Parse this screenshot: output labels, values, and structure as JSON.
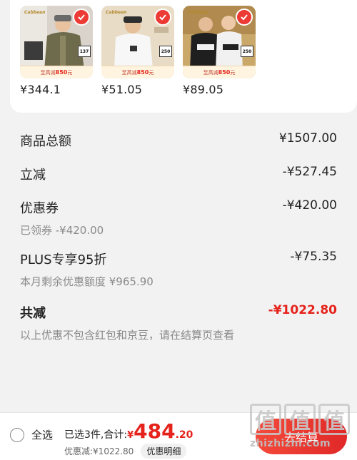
{
  "products": [
    {
      "price": "¥344.1",
      "promo_prefix": "至高减",
      "promo_amount": "850",
      "promo_suffix": "元",
      "tag": "137",
      "brand": "Cabbeen"
    },
    {
      "price": "¥51.05",
      "promo_prefix": "至高减",
      "promo_amount": "850",
      "promo_suffix": "元",
      "tag": "250",
      "brand": "Cabbeen"
    },
    {
      "price": "¥89.05",
      "promo_prefix": "至高减",
      "promo_amount": "850",
      "promo_suffix": "元",
      "tag": "250",
      "brand": "Cabbeen"
    }
  ],
  "summary": {
    "total_label": "商品总额",
    "total_value": "¥1507.00",
    "instant_label": "立减",
    "instant_value": "-¥527.45",
    "coupon_label": "优惠券",
    "coupon_value": "-¥420.00",
    "coupon_sub": "已领券 -¥420.00",
    "plus_label": "PLUS专享95折",
    "plus_value": "-¥75.35",
    "plus_sub": "本月剩余优惠额度 ¥965.90",
    "all_label": "共减",
    "all_value": "-¥1022.80",
    "note": "以上优惠不包含红包和京豆，请在结算页查看"
  },
  "bottom": {
    "select_all": "全选",
    "selected_label": "已选3件,合计:",
    "currency": "¥",
    "amount_int": "484",
    "amount_dec": ".20",
    "discount": "优惠减:¥1022.80",
    "detail_button": "优惠明细",
    "checkout": "去结算"
  },
  "watermark": {
    "glyph": "值",
    "url": "zhizhizhi.com"
  },
  "colors": {
    "accent": "#e5231c",
    "check": "#ec3a35"
  }
}
